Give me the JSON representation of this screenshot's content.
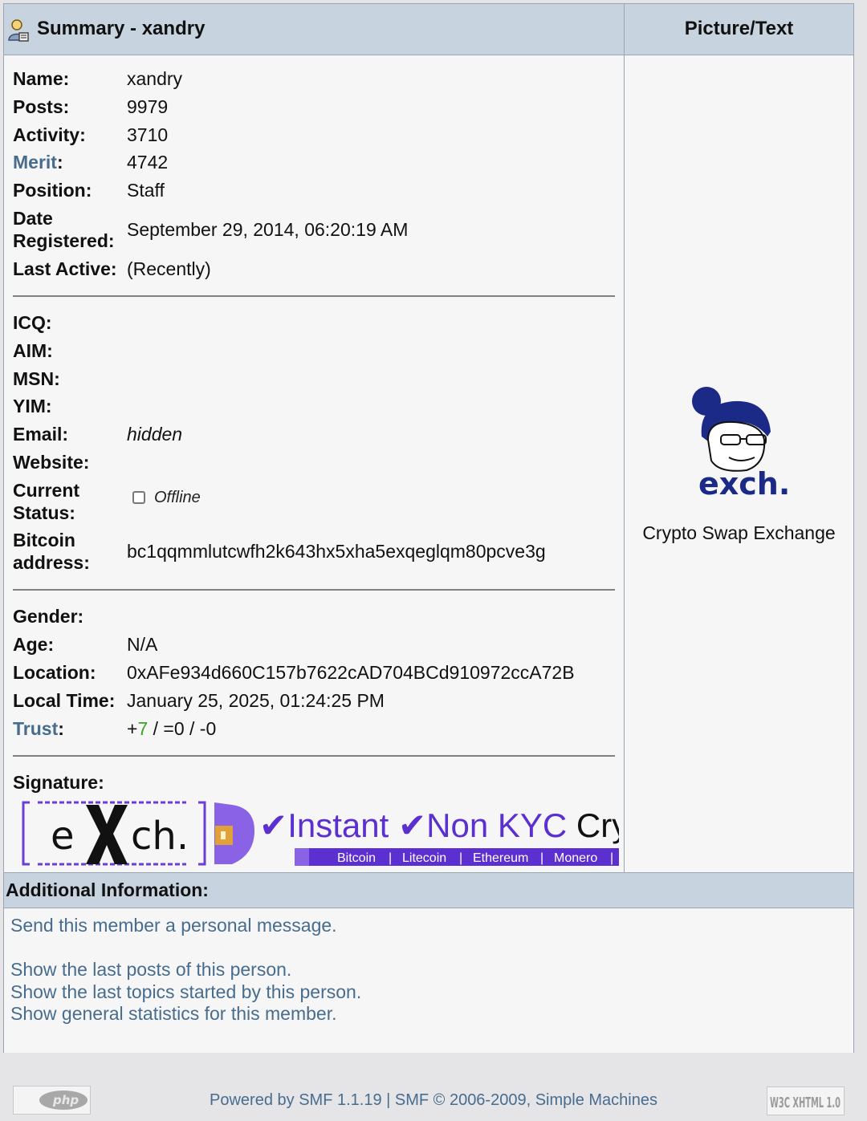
{
  "header": {
    "summary_title": "Summary - xandry",
    "picture_title": "Picture/Text"
  },
  "profile": {
    "name_label": "Name:",
    "name": "xandry",
    "posts_label": "Posts:",
    "posts": "9979",
    "activity_label": "Activity:",
    "activity": "3710",
    "merit_label": "Merit",
    "merit": "4742",
    "position_label": "Position:",
    "position": "Staff",
    "date_label_1": "Date",
    "date_label_2": "Registered:",
    "date_registered": "September 29, 2014, 06:20:19 AM",
    "last_active_label": "Last Active:",
    "last_active": "(Recently)"
  },
  "contact": {
    "icq_label": "ICQ:",
    "aim_label": "AIM:",
    "msn_label": "MSN:",
    "yim_label": "YIM:",
    "email_label": "Email:",
    "email": "hidden",
    "website_label": "Website:",
    "status_label_1": "Current",
    "status_label_2": "Status:",
    "status": "Offline",
    "bitcoin_label_1": "Bitcoin",
    "bitcoin_label_2": "address:",
    "bitcoin_address": "bc1qqmmlutcwfh2k643hx5xha5exqeglqm80pcve3g"
  },
  "personal": {
    "gender_label": "Gender:",
    "age_label": "Age:",
    "age": "N/A",
    "location_label": "Location:",
    "location": "0xAFe934d660C157b7622cAD704BCd910972ccA72B",
    "local_time_label": "Local Time:",
    "local_time": "January 25, 2025, 01:24:25 PM",
    "trust_label": "Trust",
    "trust_plus": "+",
    "trust_pos": "7",
    "trust_rest": " / =0 / -0"
  },
  "signature": {
    "label": "Signature:",
    "brand_e": "e",
    "brand_ch": "ch.",
    "tagline": "✔Instant ✔Non KYC Cry",
    "tagline_last": "Cry",
    "coins": [
      "Bitcoin",
      "Litecoin",
      "Ethereum",
      "Monero"
    ]
  },
  "avatar": {
    "logo_text": "exch.",
    "caption": "Crypto Swap Exchange"
  },
  "additional": {
    "header": "Additional Information:",
    "pm": "Send this member a personal message.",
    "last_posts": "Show the last posts of this person.",
    "last_topics": "Show the last topics started by this person.",
    "stats": "Show general statistics for this member."
  },
  "footer": {
    "text": "Powered by SMF 1.1.19 | SMF © 2006-2009, Simple Machines",
    "php_badge": "php",
    "w3c_badge": "W3C XHTML 1.0"
  },
  "colors": {
    "link": "#476c8e",
    "header_bg": "#c7d3de",
    "trust_positive": "#3ea22a",
    "brand_purple": "#5b2fd0"
  }
}
